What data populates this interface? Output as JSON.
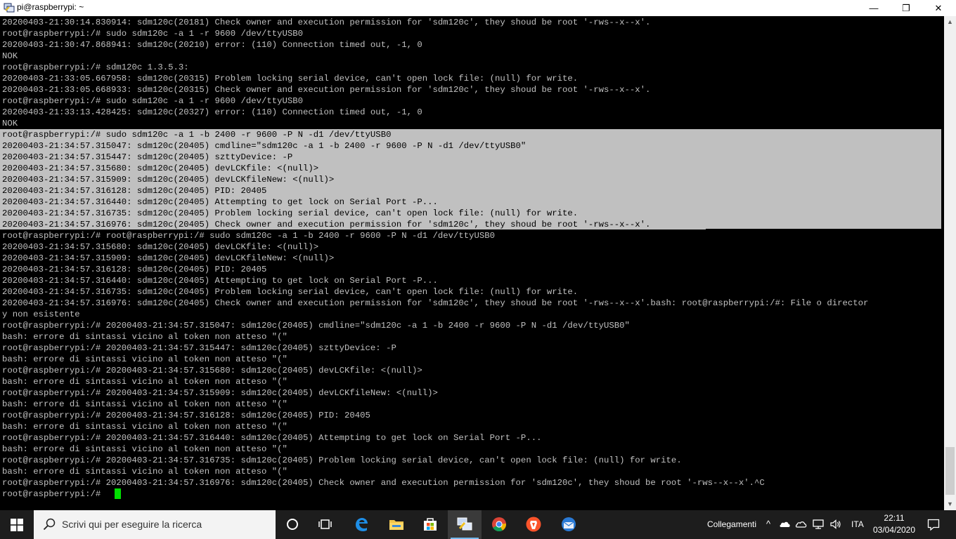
{
  "window": {
    "title": "pi@raspberrypi: ~",
    "minimize_icon": "minimize-icon",
    "maximize_icon": "restore-icon",
    "close_icon": "close-icon",
    "minimize_glyph": "—",
    "maximize_glyph": "❐",
    "close_glyph": "✕"
  },
  "terminal": {
    "lines": [
      "20200403-21:30:14.830914: sdm120c(20181) Check owner and execution permission for 'sdm120c', they shoud be root '-rws--x--x'.",
      "root@raspberrypi:/# sudo sdm120c -a 1 -r 9600 /dev/ttyUSB0",
      "20200403-21:30:47.868941: sdm120c(20210) error: (110) Connection timed out, -1, 0",
      "NOK",
      "root@raspberrypi:/# sdm120c 1.3.5.3:",
      "20200403-21:33:05.667958: sdm120c(20315) Problem locking serial device, can't open lock file: (null) for write.",
      "20200403-21:33:05.668933: sdm120c(20315) Check owner and execution permission for 'sdm120c', they shoud be root '-rws--x--x'.",
      "root@raspberrypi:/# sudo sdm120c -a 1 -r 9600 /dev/ttyUSB0",
      "20200403-21:33:13.428425: sdm120c(20327) error: (110) Connection timed out, -1, 0",
      "NOK",
      "root@raspberrypi:/# sudo sdm120c -a 1 -b 2400 -r 9600 -P N -d1 /dev/ttyUSB0",
      "20200403-21:34:57.315047: sdm120c(20405) cmdline=\"sdm120c -a 1 -b 2400 -r 9600 -P N -d1 /dev/ttyUSB0\"",
      "20200403-21:34:57.315447: sdm120c(20405) szttyDevice: -P",
      "20200403-21:34:57.315680: sdm120c(20405) devLCKfile: <(null)>",
      "20200403-21:34:57.315909: sdm120c(20405) devLCKfileNew: <(null)>",
      "20200403-21:34:57.316128: sdm120c(20405) PID: 20405",
      "20200403-21:34:57.316440: sdm120c(20405) Attempting to get lock on Serial Port -P...",
      "20200403-21:34:57.316735: sdm120c(20405) Problem locking serial device, can't open lock file: (null) for write.",
      "20200403-21:34:57.316976: sdm120c(20405) Check owner and execution permission for 'sdm120c', they shoud be root '-rws--x--x'.",
      "root@raspberrypi:/# root@raspberrypi:/# sudo sdm120c -a 1 -b 2400 -r 9600 -P N -d1 /dev/ttyUSB0",
      "20200403-21:34:57.315680: sdm120c(20405) devLCKfile: <(null)>",
      "20200403-21:34:57.315909: sdm120c(20405) devLCKfileNew: <(null)>",
      "20200403-21:34:57.316128: sdm120c(20405) PID: 20405",
      "20200403-21:34:57.316440: sdm120c(20405) Attempting to get lock on Serial Port -P...",
      "20200403-21:34:57.316735: sdm120c(20405) Problem locking serial device, can't open lock file: (null) for write.",
      "20200403-21:34:57.316976: sdm120c(20405) Check owner and execution permission for 'sdm120c', they shoud be root '-rws--x--x'.bash: root@raspberrypi:/#: File o director",
      "y non esistente",
      "root@raspberrypi:/# 20200403-21:34:57.315047: sdm120c(20405) cmdline=\"sdm120c -a 1 -b 2400 -r 9600 -P N -d1 /dev/ttyUSB0\"",
      "bash: errore di sintassi vicino al token non atteso \"(\"",
      "root@raspberrypi:/# 20200403-21:34:57.315447: sdm120c(20405) szttyDevice: -P",
      "bash: errore di sintassi vicino al token non atteso \"(\"",
      "root@raspberrypi:/# 20200403-21:34:57.315680: sdm120c(20405) devLCKfile: <(null)>",
      "bash: errore di sintassi vicino al token non atteso \"(\"",
      "root@raspberrypi:/# 20200403-21:34:57.315909: sdm120c(20405) devLCKfileNew: <(null)>",
      "bash: errore di sintassi vicino al token non atteso \"(\"",
      "root@raspberrypi:/# 20200403-21:34:57.316128: sdm120c(20405) PID: 20405",
      "bash: errore di sintassi vicino al token non atteso \"(\"",
      "root@raspberrypi:/# 20200403-21:34:57.316440: sdm120c(20405) Attempting to get lock on Serial Port -P...",
      "bash: errore di sintassi vicino al token non atteso \"(\"",
      "root@raspberrypi:/# 20200403-21:34:57.316735: sdm120c(20405) Problem locking serial device, can't open lock file: (null) for write.",
      "bash: errore di sintassi vicino al token non atteso \"(\"",
      "root@raspberrypi:/# 20200403-21:34:57.316976: sdm120c(20405) Check owner and execution permission for 'sdm120c', they shoud be root '-rws--x--x'.^C",
      "root@raspberrypi:/# "
    ],
    "selected_line_range": [
      10,
      18
    ],
    "text_color": "#c0c0c0",
    "selection_color": "#c0c0c0",
    "cursor_color": "#00e000",
    "background": "#000000"
  },
  "scrollbar": {
    "up_arrow": "▲",
    "down_arrow": "▼"
  },
  "taskbar": {
    "start_icon": "windows-start-icon",
    "search_placeholder": "Scrivi qui per eseguire la ricerca",
    "pinned": [
      "cortana-icon",
      "task-view-icon",
      "edge-icon",
      "file-explorer-icon",
      "store-icon",
      "putty-icon",
      "chrome-icon",
      "brave-icon",
      "thunderbird-icon"
    ],
    "active_app": "putty-icon",
    "tray": {
      "links_label": "Collegamenti",
      "chevron_glyph": "^",
      "language": "ITA",
      "time": "22:11",
      "date": "03/04/2020"
    },
    "accent_color": "#76b9ed"
  }
}
